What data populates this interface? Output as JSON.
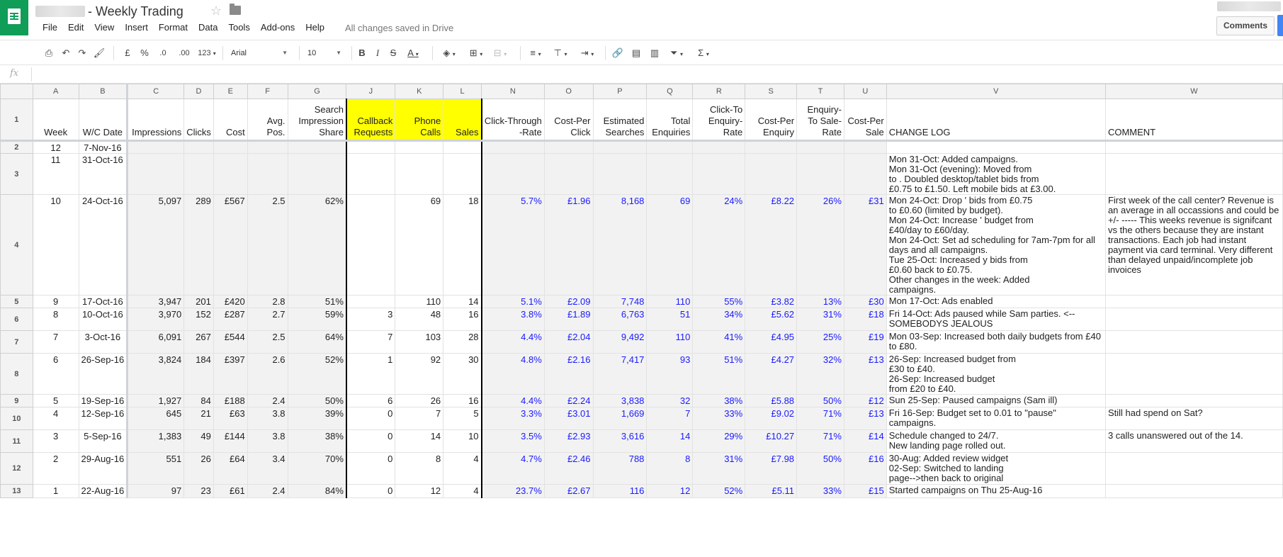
{
  "app": {
    "title": "- Weekly Trading",
    "save_status": "All changes saved in Drive",
    "comments_label": "Comments",
    "menu": [
      "File",
      "Edit",
      "View",
      "Insert",
      "Format",
      "Data",
      "Tools",
      "Add-ons",
      "Help"
    ]
  },
  "toolbar": {
    "currency": "£",
    "percent": "%",
    "dec_decrease": ".0",
    "dec_increase": ".00",
    "more_formats": "123",
    "font": "Arial",
    "font_size": "10",
    "bold": "B",
    "italic": "I",
    "strike": "S",
    "text_color": "A",
    "functions": "Σ"
  },
  "formula_bar": {
    "fx": "fx"
  },
  "columns": [
    "A",
    "B",
    "C",
    "D",
    "E",
    "F",
    "G",
    "J",
    "K",
    "L",
    "N",
    "O",
    "P",
    "Q",
    "R",
    "S",
    "T",
    "U",
    "V",
    "W"
  ],
  "header_row": {
    "week": "Week",
    "wc_date": "W/C Date",
    "impressions": "Impressions",
    "clicks": "Clicks",
    "cost": "Cost",
    "avg_pos": "Avg. Pos.",
    "search_share": "Search Impression Share",
    "callback": "Callback Requests",
    "phone_calls": "Phone Calls",
    "sales": "Sales",
    "ctr": "Click-Through -Rate",
    "cpc": "Cost-Per Click",
    "est_searches": "Estimated Searches",
    "total_enq": "Total Enquiries",
    "click_enq_rate": "Click-To Enquiry-Rate",
    "cost_per_enq": "Cost-Per Enquiry",
    "enq_sale_rate": "Enquiry-To Sale-Rate",
    "cost_per_sale": "Cost-Per Sale",
    "change_log": "CHANGE LOG",
    "comment": "COMMENT"
  },
  "rows": [
    {
      "n": "2",
      "week": "12",
      "date": "7-Nov-16",
      "imp": "",
      "clicks": "",
      "cost": "",
      "pos": "",
      "share": "",
      "cb": "",
      "calls": "",
      "sales": "",
      "ctr": "",
      "cpc": "",
      "est": "",
      "enq": "",
      "c2e": "",
      "cpe": "",
      "e2s": "",
      "cps": "",
      "log": "",
      "comment": ""
    },
    {
      "n": "3",
      "week": "11",
      "date": "31-Oct-16",
      "imp": "",
      "clicks": "",
      "cost": "",
      "pos": "",
      "share": "",
      "cb": "",
      "calls": "",
      "sales": "",
      "ctr": "",
      "cpc": "",
      "est": "",
      "enq": "",
      "c2e": "",
      "cpe": "",
      "e2s": "",
      "cps": "",
      "log": "Mon 31-Oct: Added campaigns.\nMon 31-Oct (evening): Moved from\nto . Doubled desktop/tablet bids from\n£0.75 to £1.50. Left mobile bids at £3.00.",
      "comment": ""
    },
    {
      "n": "4",
      "week": "10",
      "date": "24-Oct-16",
      "imp": "5,097",
      "clicks": "289",
      "cost": "£567",
      "pos": "2.5",
      "share": "62%",
      "cb": "",
      "calls": "69",
      "sales": "18",
      "ctr": "5.7%",
      "cpc": "£1.96",
      "est": "8,168",
      "enq": "69",
      "c2e": "24%",
      "cpe": "£8.22",
      "e2s": "26%",
      "cps": "£31",
      "log": "Mon 24-Oct: Drop ' bids from £0.75\nto £0.60 (limited by budget).\nMon 24-Oct: Increase ' budget from\n£40/day to £60/day.\nMon 24-Oct: Set ad scheduling for 7am-7pm for all\ndays and all campaigns.\nTue 25-Oct: Increased y bids from\n£0.60 back to £0.75.\nOther changes in the week: Added\ncampaigns.",
      "comment": "First week of the call center? Revenue is an average in all occassions and could be +/- ----- This weeks revenue is signifcant vs the others because they are instant transactions. Each job had instant payment via card terminal. Very different than delayed unpaid/incomplete job invoices"
    },
    {
      "n": "5",
      "week": "9",
      "date": "17-Oct-16",
      "imp": "3,947",
      "clicks": "201",
      "cost": "£420",
      "pos": "2.8",
      "share": "51%",
      "cb": "",
      "calls": "110",
      "sales": "14",
      "ctr": "5.1%",
      "cpc": "£2.09",
      "est": "7,748",
      "enq": "110",
      "c2e": "55%",
      "cpe": "£3.82",
      "e2s": "13%",
      "cps": "£30",
      "log": "Mon 17-Oct: Ads enabled",
      "comment": ""
    },
    {
      "n": "6",
      "week": "8",
      "date": "10-Oct-16",
      "imp": "3,970",
      "clicks": "152",
      "cost": "£287",
      "pos": "2.7",
      "share": "59%",
      "cb": "3",
      "calls": "48",
      "sales": "16",
      "ctr": "3.8%",
      "cpc": "£1.89",
      "est": "6,763",
      "enq": "51",
      "c2e": "34%",
      "cpe": "£5.62",
      "e2s": "31%",
      "cps": "£18",
      "log": "Fri 14-Oct: Ads paused while Sam parties. <--\nSOMEBODYS JEALOUS",
      "comment": ""
    },
    {
      "n": "7",
      "week": "7",
      "date": "3-Oct-16",
      "imp": "6,091",
      "clicks": "267",
      "cost": "£544",
      "pos": "2.5",
      "share": "64%",
      "cb": "7",
      "calls": "103",
      "sales": "28",
      "ctr": "4.4%",
      "cpc": "£2.04",
      "est": "9,492",
      "enq": "110",
      "c2e": "41%",
      "cpe": "£4.95",
      "e2s": "25%",
      "cps": "£19",
      "log": "Mon 03-Sep: Increased both daily budgets from £40\nto £80.",
      "comment": ""
    },
    {
      "n": "8",
      "week": "6",
      "date": "26-Sep-16",
      "imp": "3,824",
      "clicks": "184",
      "cost": "£397",
      "pos": "2.6",
      "share": "52%",
      "cb": "1",
      "calls": "92",
      "sales": "30",
      "ctr": "4.8%",
      "cpc": "£2.16",
      "est": "7,417",
      "enq": "93",
      "c2e": "51%",
      "cpe": "£4.27",
      "e2s": "32%",
      "cps": "£13",
      "log": "26-Sep: Increased budget from\n£30 to £40.\n26-Sep: Increased budget\nfrom £20 to £40.",
      "comment": ""
    },
    {
      "n": "9",
      "week": "5",
      "date": "19-Sep-16",
      "imp": "1,927",
      "clicks": "84",
      "cost": "£188",
      "pos": "2.4",
      "share": "50%",
      "cb": "6",
      "calls": "26",
      "sales": "16",
      "ctr": "4.4%",
      "cpc": "£2.24",
      "est": "3,838",
      "enq": "32",
      "c2e": "38%",
      "cpe": "£5.88",
      "e2s": "50%",
      "cps": "£12",
      "log": "Sun 25-Sep: Paused campaigns (Sam ill)",
      "comment": ""
    },
    {
      "n": "10",
      "week": "4",
      "date": "12-Sep-16",
      "imp": "645",
      "clicks": "21",
      "cost": "£63",
      "pos": "3.8",
      "share": "39%",
      "cb": "0",
      "calls": "7",
      "sales": "5",
      "ctr": "3.3%",
      "cpc": "£3.01",
      "est": "1,669",
      "enq": "7",
      "c2e": "33%",
      "cpe": "£9.02",
      "e2s": "71%",
      "cps": "£13",
      "log": "Fri 16-Sep: Budget set to 0.01 to \"pause\"\ncampaigns.",
      "comment": "Still had spend on Sat?"
    },
    {
      "n": "11",
      "week": "3",
      "date": "5-Sep-16",
      "imp": "1,383",
      "clicks": "49",
      "cost": "£144",
      "pos": "3.8",
      "share": "38%",
      "cb": "0",
      "calls": "14",
      "sales": "10",
      "ctr": "3.5%",
      "cpc": "£2.93",
      "est": "3,616",
      "enq": "14",
      "c2e": "29%",
      "cpe": "£10.27",
      "e2s": "71%",
      "cps": "£14",
      "log": "Schedule changed to 24/7.\nNew landing page rolled out.",
      "comment": "3 calls unanswered out of the 14."
    },
    {
      "n": "12",
      "week": "2",
      "date": "29-Aug-16",
      "imp": "551",
      "clicks": "26",
      "cost": "£64",
      "pos": "3.4",
      "share": "70%",
      "cb": "0",
      "calls": "8",
      "sales": "4",
      "ctr": "4.7%",
      "cpc": "£2.46",
      "est": "788",
      "enq": "8",
      "c2e": "31%",
      "cpe": "£7.98",
      "e2s": "50%",
      "cps": "£16",
      "log": "30-Aug: Added review widget\n02-Sep: Switched to landing\npage-->then back to original",
      "comment": ""
    },
    {
      "n": "13",
      "week": "1",
      "date": "22-Aug-16",
      "imp": "97",
      "clicks": "23",
      "cost": "£61",
      "pos": "2.4",
      "share": "84%",
      "cb": "0",
      "calls": "12",
      "sales": "4",
      "ctr": "23.7%",
      "cpc": "£2.67",
      "est": "116",
      "enq": "12",
      "c2e": "52%",
      "cpe": "£5.11",
      "e2s": "33%",
      "cps": "£15",
      "log": "Started campaigns on Thu 25-Aug-16",
      "comment": ""
    }
  ],
  "colors": {
    "brand_green": "#0f9d58",
    "highlight_yellow": "#ffff00",
    "metric_blue": "#1a1aff"
  }
}
